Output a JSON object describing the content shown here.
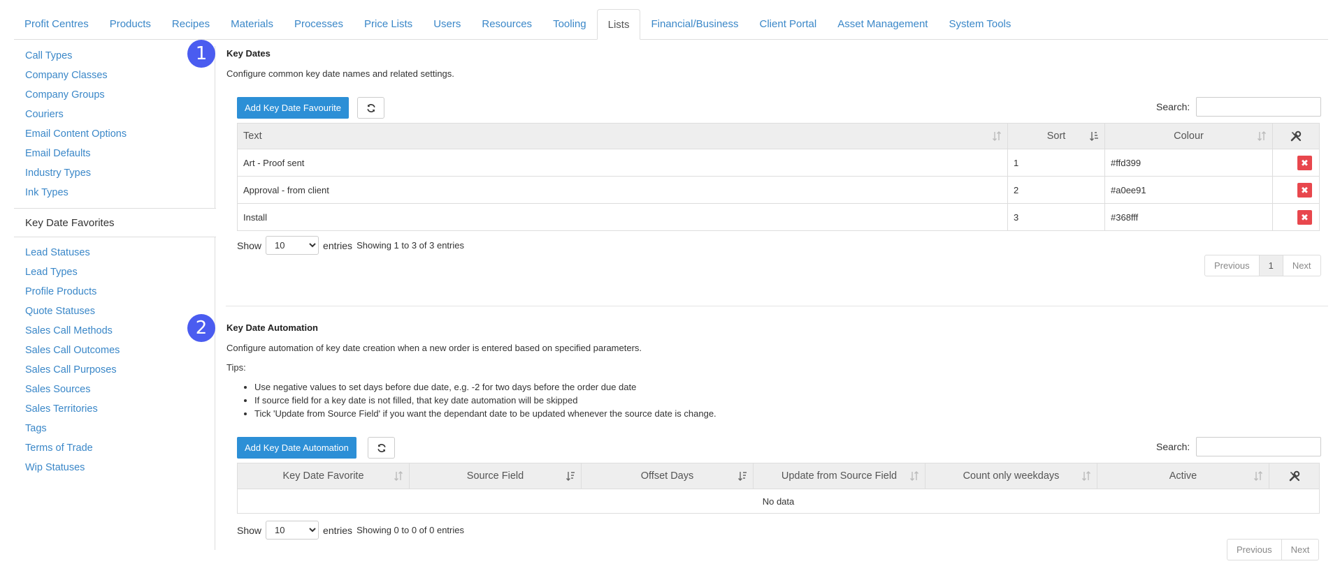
{
  "top_tabs": [
    {
      "label": "Profit Centres"
    },
    {
      "label": "Products"
    },
    {
      "label": "Recipes"
    },
    {
      "label": "Materials"
    },
    {
      "label": "Processes"
    },
    {
      "label": "Price Lists"
    },
    {
      "label": "Users"
    },
    {
      "label": "Resources"
    },
    {
      "label": "Tooling"
    },
    {
      "label": "Lists",
      "active": true
    },
    {
      "label": "Financial/Business"
    },
    {
      "label": "Client Portal"
    },
    {
      "label": "Asset Management"
    },
    {
      "label": "System Tools"
    }
  ],
  "sidebar": {
    "items": [
      "Call Types",
      "Company Classes",
      "Company Groups",
      "Couriers",
      "Email Content Options",
      "Email Defaults",
      "Industry Types",
      "Ink Types",
      "Key Date Favorites",
      "Lead Statuses",
      "Lead Types",
      "Profile Products",
      "Quote Statuses",
      "Sales Call Methods",
      "Sales Call Outcomes",
      "Sales Call Purposes",
      "Sales Sources",
      "Sales Territories",
      "Tags",
      "Terms of Trade",
      "Wip Statuses"
    ],
    "active_item": "Key Date Favorites"
  },
  "badges": {
    "one": "1",
    "two": "2"
  },
  "key_dates": {
    "title": "Key Dates",
    "description": "Configure common key date names and related settings.",
    "add_button": "Add Key Date Favourite",
    "search_label": "Search:",
    "columns": {
      "text": "Text",
      "sort": "Sort",
      "colour": "Colour"
    },
    "rows": [
      {
        "text": "Art - Proof sent",
        "sort": "1",
        "colour": "#ffd399"
      },
      {
        "text": "Approval - from client",
        "sort": "2",
        "colour": "#a0ee91"
      },
      {
        "text": "Install",
        "sort": "3",
        "colour": "#368fff"
      }
    ],
    "show_label": "Show",
    "entries_value": "10",
    "entries_label": "entries",
    "info": "Showing 1 to 3 of 3 entries",
    "pager": {
      "previous": "Previous",
      "page": "1",
      "next": "Next"
    }
  },
  "automation": {
    "title": "Key Date Automation",
    "description": "Configure automation of key date creation when a new order is entered based on specified parameters.",
    "tips_label": "Tips:",
    "tips": [
      "Use negative values to set days before due date, e.g. -2 for two days before the order due date",
      "If source field for a key date is not filled, that key date automation will be skipped",
      "Tick 'Update from Source Field' if you want the dependant date to be updated whenever the source date is change."
    ],
    "add_button": "Add Key Date Automation",
    "search_label": "Search:",
    "columns": {
      "favorite": "Key Date Favorite",
      "source": "Source Field",
      "offset": "Offset Days",
      "update": "Update from Source Field",
      "weekdays": "Count only weekdays",
      "active": "Active"
    },
    "empty": "No data",
    "show_label": "Show",
    "entries_value": "10",
    "entries_label": "entries",
    "info": "Showing 0 to 0 of 0 entries",
    "pager": {
      "previous": "Previous",
      "next": "Next"
    }
  },
  "icons": {
    "refresh": "refresh-icon",
    "tools": "wrench-screwdriver-icon",
    "sort": "sort-icon",
    "delete": "delete-x-icon"
  },
  "colors": {
    "accent": "#2c8fd6",
    "badge": "#4a5cf0",
    "danger": "#e8474d",
    "link": "#3a87c8"
  }
}
